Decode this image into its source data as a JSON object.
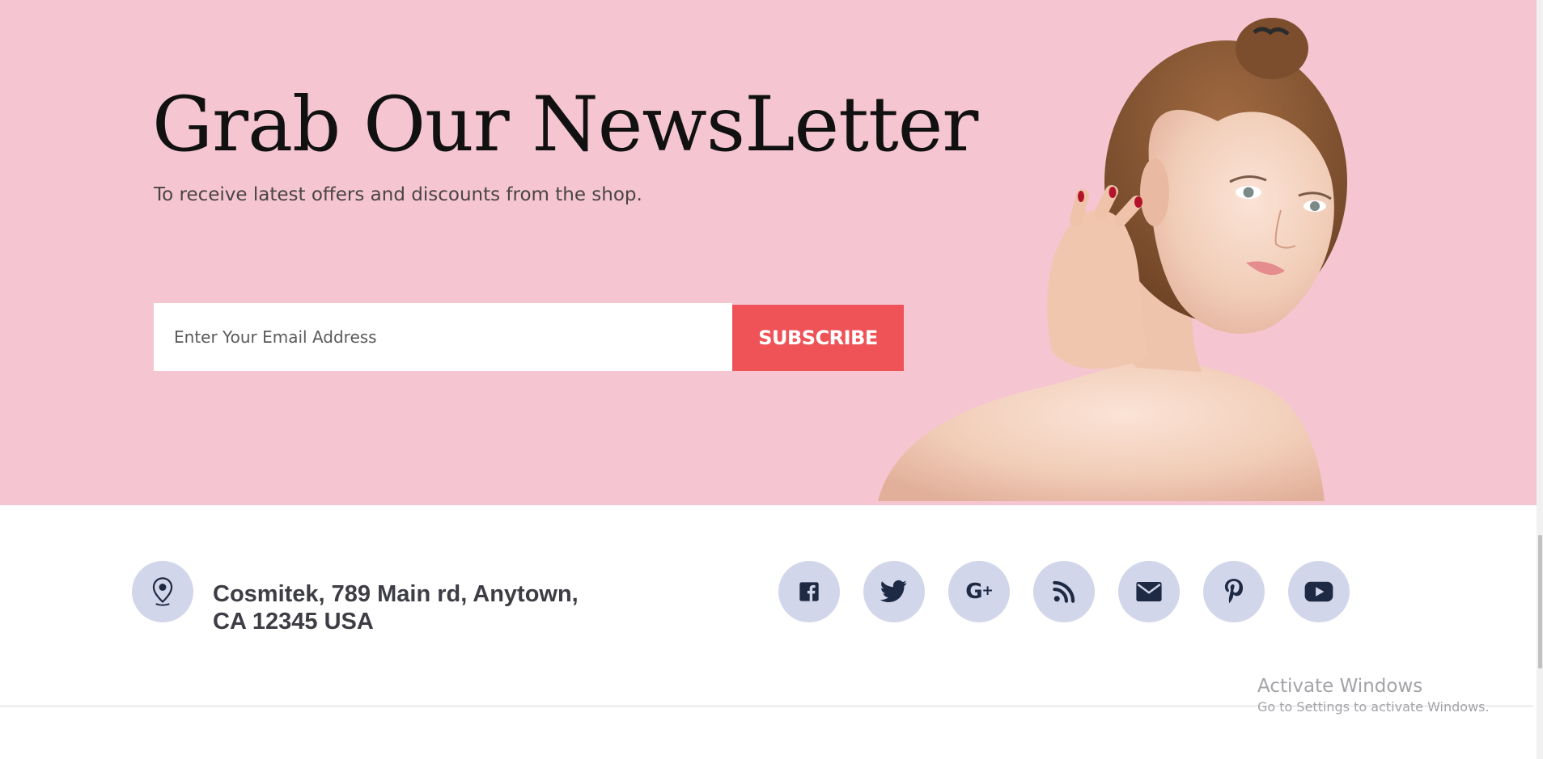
{
  "newsletter": {
    "heading": "Grab Our NewsLetter",
    "subheading": "To receive latest offers and discounts from the shop.",
    "email_placeholder": "Enter Your Email Address",
    "subscribe_label": "SUBSCRIBE",
    "background_color": "#f5c6d2",
    "button_color": "#ef5358"
  },
  "contact": {
    "icon": "location-pin-icon",
    "address_line1": "Cosmitek, 789 Main rd, Anytown,",
    "address_line2": "CA 12345 USA"
  },
  "social_links": [
    {
      "icon": "facebook-icon"
    },
    {
      "icon": "twitter-icon"
    },
    {
      "icon": "google-plus-icon"
    },
    {
      "icon": "rss-icon"
    },
    {
      "icon": "email-icon"
    },
    {
      "icon": "pinterest-icon"
    },
    {
      "icon": "youtube-icon"
    }
  ],
  "social_icon_bg": "#d2d6ea",
  "social_icon_color": "#1e2a44",
  "watermark": {
    "title": "Activate Windows",
    "subtitle": "Go to Settings to activate Windows."
  }
}
